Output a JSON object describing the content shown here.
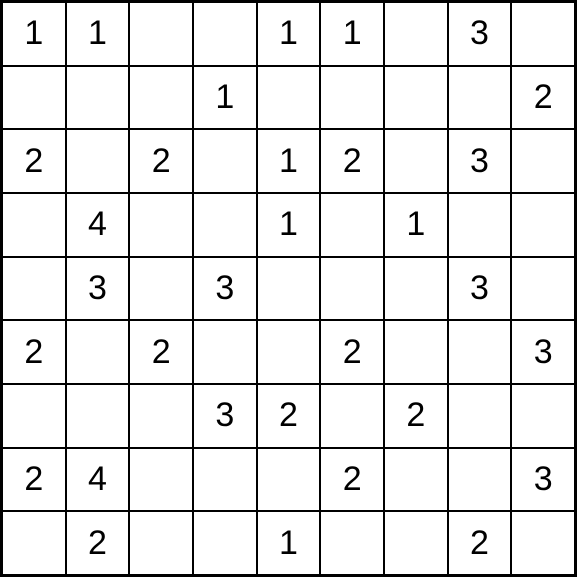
{
  "puzzle": {
    "type": "number-grid",
    "rows": 9,
    "cols": 9,
    "cells": [
      [
        "1",
        "1",
        "",
        "",
        "1",
        "1",
        "",
        "3",
        ""
      ],
      [
        "",
        "",
        "",
        "1",
        "",
        "",
        "",
        "",
        "2"
      ],
      [
        "2",
        "",
        "2",
        "",
        "1",
        "2",
        "",
        "3",
        ""
      ],
      [
        "",
        "4",
        "",
        "",
        "1",
        "",
        "1",
        "",
        ""
      ],
      [
        "",
        "3",
        "",
        "3",
        "",
        "",
        "",
        "3",
        ""
      ],
      [
        "2",
        "",
        "2",
        "",
        "",
        "2",
        "",
        "",
        "3"
      ],
      [
        "",
        "",
        "",
        "3",
        "2",
        "",
        "2",
        "",
        ""
      ],
      [
        "2",
        "4",
        "",
        "",
        "",
        "2",
        "",
        "",
        "3"
      ],
      [
        "",
        "2",
        "",
        "",
        "1",
        "",
        "",
        "2",
        ""
      ]
    ]
  }
}
